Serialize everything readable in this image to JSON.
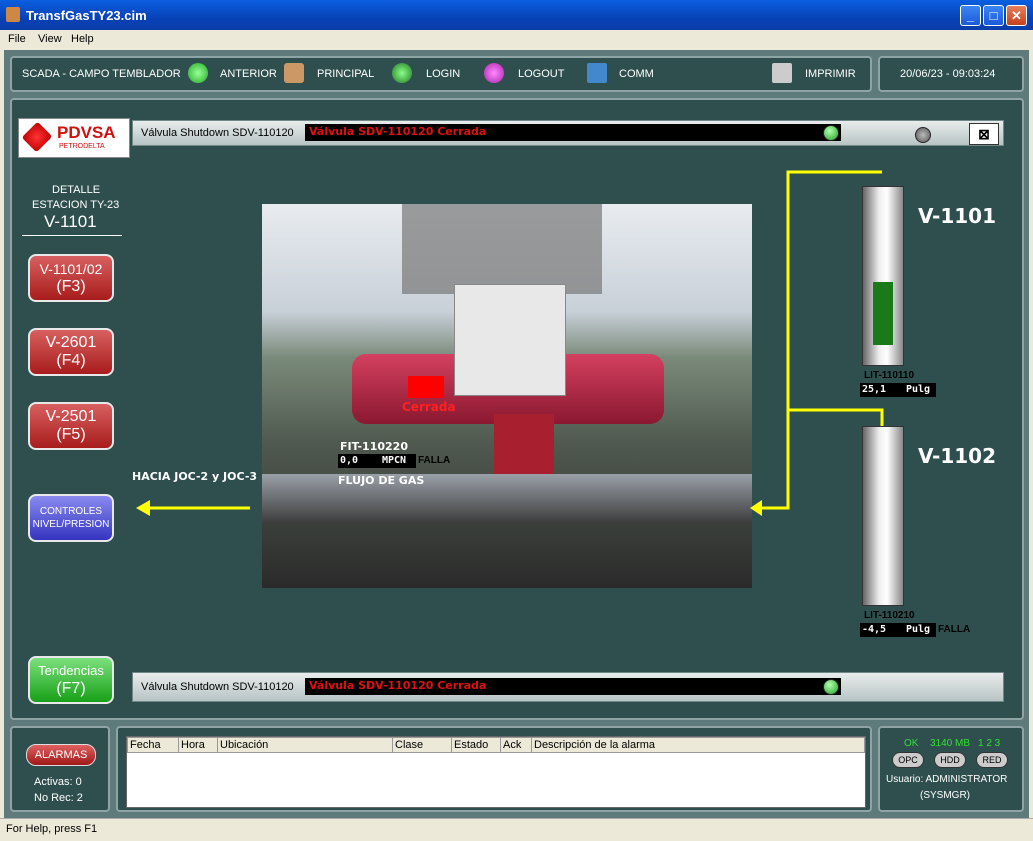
{
  "window": {
    "title": "TransfGasTY23.cim",
    "minimize": "_",
    "maximize": "□",
    "close": "✕"
  },
  "menu": [
    "File",
    "View",
    "Help"
  ],
  "nav": {
    "station": "SCADA - CAMPO TEMBLADOR",
    "back": "ANTERIOR",
    "home": "PRINCIPAL",
    "login": "LOGIN",
    "logout": "LOGOUT",
    "comm": "COMM",
    "print": "IMPRIMIR",
    "datetime": "20/06/23 - 09:03:24"
  },
  "logo": {
    "brand": "PDVSA",
    "sub": "PETRODELTA"
  },
  "sidebar": {
    "detail_line1": "DETALLE",
    "detail_line2": "ESTACION TY-23",
    "vessel": "V-1101",
    "buttons": [
      {
        "label": "V-1101/02",
        "key": "(F3)"
      },
      {
        "label": "V-2601",
        "key": "(F4)"
      },
      {
        "label": "V-2501",
        "key": "(F5)"
      }
    ],
    "controls_line1": "CONTROLES",
    "controls_line2": "NIVEL/PRESION",
    "trend_label": "Tendencias",
    "trend_key": "(F7)"
  },
  "valve_header": {
    "label": "Válvula Shutdown SDV-110120",
    "status": "Válvula SDV-110120 Cerrada"
  },
  "valve_footer": {
    "label": "Válvula Shutdown SDV-110120",
    "status": "Válvula SDV-110120 Cerrada"
  },
  "photo": {
    "valve_state": "Cerrada",
    "flow_tag": "FIT-110220",
    "flow_value": "0,0",
    "flow_unit": "MPCN",
    "flow_fault": "FALLA",
    "flow_desc": "FLUJO DE GAS"
  },
  "outlet_label": "HACIA JOC-2 y JOC-3",
  "tanks": [
    {
      "name": "V-1101",
      "tag": "LIT-110110",
      "value": "25,1",
      "unit": "Pulg",
      "fault": "",
      "level": 0.42
    },
    {
      "name": "V-1102",
      "tag": "LIT-110210",
      "value": "-4,5",
      "unit": "Pulg",
      "fault": "FALLA",
      "level": 0.0
    }
  ],
  "alarms": {
    "button": "ALARMAS",
    "active": "Activas: 0",
    "unack": "No Rec: 2",
    "columns": [
      "Fecha",
      "Hora",
      "Ubicación",
      "Clase",
      "Estado",
      "Ack",
      "Descripción de la alarma"
    ]
  },
  "system": {
    "ok": "OK",
    "memory": "3140 MB",
    "nums": "1 2 3",
    "opc": "OPC",
    "hdd": "HDD",
    "red": "RED",
    "user": "Usuario: ADMINISTRATOR",
    "group": "(SYSMGR)"
  },
  "statusbar": "For Help, press F1",
  "colors": {
    "accent_yellow": "#ffff00",
    "alarm_red": "#e01010",
    "panel": "#2f4f4f"
  }
}
